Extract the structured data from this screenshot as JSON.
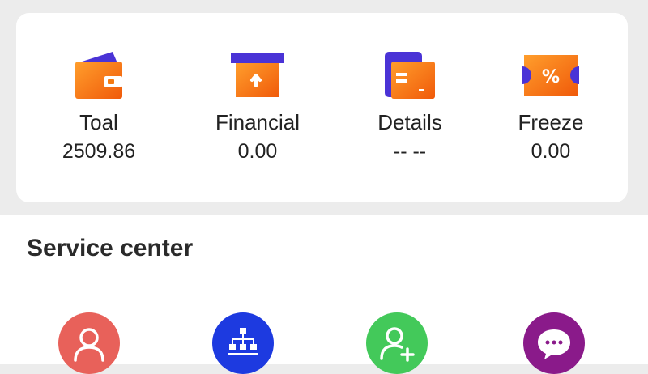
{
  "summary": {
    "items": [
      {
        "label": "Toal",
        "value": "2509.86",
        "icon": "wallet-icon"
      },
      {
        "label": "Financial",
        "value": "0.00",
        "icon": "financial-box-icon"
      },
      {
        "label": "Details",
        "value": "-- --",
        "icon": "details-wallet-icon"
      },
      {
        "label": "Freeze",
        "value": "0.00",
        "icon": "percent-ticket-icon"
      }
    ]
  },
  "service_center": {
    "title": "Service center",
    "items": [
      {
        "icon": "user-icon",
        "color": "#e8615a"
      },
      {
        "icon": "org-chart-icon",
        "color": "#1d3ae0"
      },
      {
        "icon": "add-user-icon",
        "color": "#43c95a"
      },
      {
        "icon": "chat-bubble-icon",
        "color": "#8a1a8a"
      }
    ]
  },
  "colors": {
    "icon_orange": "#f47a12",
    "icon_orange_light": "#ff9e2c",
    "icon_purple": "#4a33d6",
    "page_background": "#ececec"
  }
}
